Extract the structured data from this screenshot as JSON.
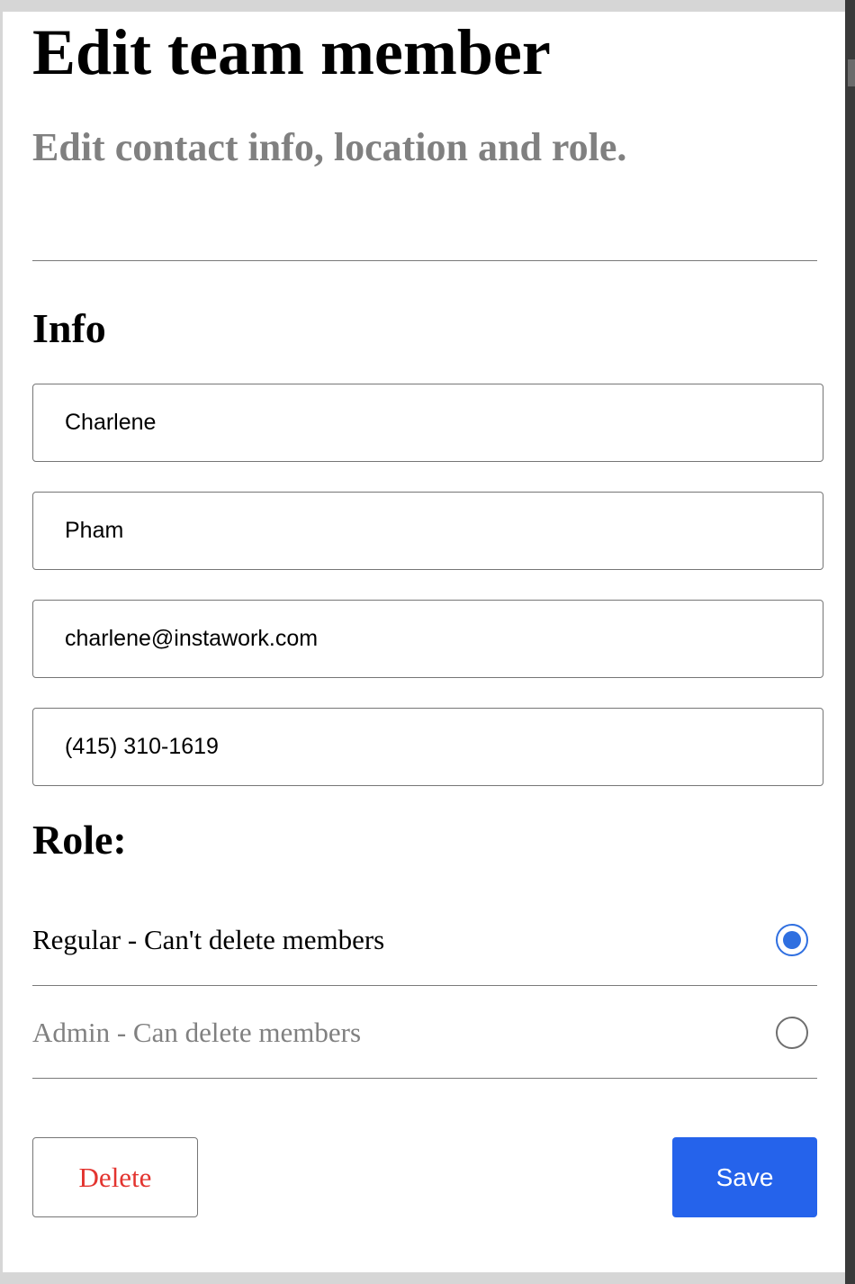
{
  "header": {
    "title": "Edit team member",
    "subtitle": "Edit contact info, location and role."
  },
  "info": {
    "heading": "Info",
    "fields": [
      {
        "name": "first-name",
        "value": "Charlene"
      },
      {
        "name": "last-name",
        "value": "Pham"
      },
      {
        "name": "email",
        "value": "charlene@instawork.com"
      },
      {
        "name": "phone",
        "value": "(415) 310-1619"
      }
    ]
  },
  "role": {
    "heading": "Role:",
    "options": [
      {
        "label": "Regular - Can't delete members",
        "selected": true
      },
      {
        "label": "Admin - Can delete members",
        "selected": false
      }
    ]
  },
  "actions": {
    "delete_label": "Delete",
    "save_label": "Save"
  },
  "colors": {
    "accent": "#2563eb",
    "radio_selected": "#2f6fe0",
    "danger": "#e3342f",
    "muted_text": "#808080"
  }
}
